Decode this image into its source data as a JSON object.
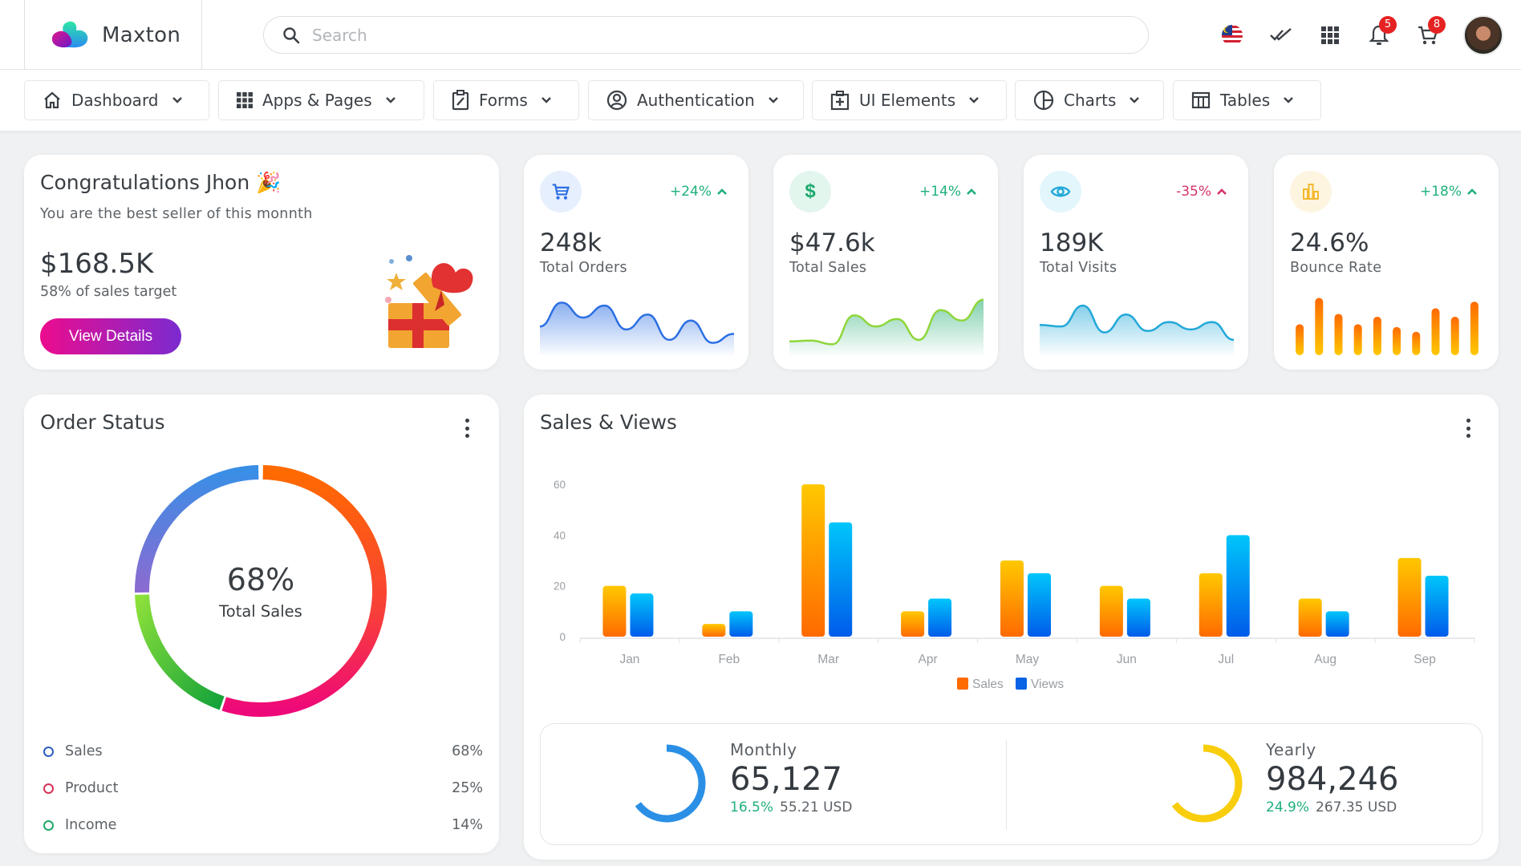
{
  "header": {
    "brand": "Maxton",
    "search_placeholder": "Search",
    "icons": [
      {
        "name": "malaysia-flag-icon"
      },
      {
        "name": "double-check-icon"
      },
      {
        "name": "apps-grid-icon"
      },
      {
        "name": "bell-icon",
        "badge": "5"
      },
      {
        "name": "cart-icon",
        "badge": "8"
      }
    ]
  },
  "nav": [
    {
      "label": "Dashboard",
      "icon": "home-icon"
    },
    {
      "label": "Apps & Pages",
      "icon": "apps-grid-icon"
    },
    {
      "label": "Forms",
      "icon": "clipboard-edit-icon"
    },
    {
      "label": "Authentication",
      "icon": "user-circle-icon"
    },
    {
      "label": "UI Elements",
      "icon": "medical-bag-icon"
    },
    {
      "label": "Charts",
      "icon": "pie-chart-icon"
    },
    {
      "label": "Tables",
      "icon": "table-icon"
    }
  ],
  "congrats": {
    "title": "Congratulations Jhon 🎉",
    "subtitle": "You are the best seller of this monnth",
    "amount": "$168.5K",
    "target": "58% of sales target",
    "button": "View Details"
  },
  "stats": [
    {
      "value": "248k",
      "label": "Total Orders",
      "change": "+24%",
      "trend": "up",
      "change_color": "#20b07a",
      "icon": "cart-icon",
      "accent": "#2c6fe3",
      "icon_bg": "#e6effd",
      "spark": {
        "type": "area",
        "values": [
          30,
          62,
          42,
          58,
          26,
          46,
          12,
          38,
          8,
          20
        ]
      }
    },
    {
      "value": "$47.6k",
      "label": "Total Sales",
      "change": "+14%",
      "trend": "up",
      "change_color": "#20b07a",
      "icon": "dollar-icon",
      "accent": "#1eaa6e",
      "icon_bg": "#e3f6ee",
      "spark": {
        "type": "area",
        "values": [
          10,
          11,
          6,
          45,
          30,
          40,
          12,
          52,
          38,
          66
        ]
      }
    },
    {
      "value": "189K",
      "label": "Total Visits",
      "change": "-35%",
      "trend": "up",
      "change_color": "#d6336c",
      "icon": "eye-icon",
      "accent": "#22a8d8",
      "icon_bg": "#e2f6fc",
      "spark": {
        "type": "area",
        "values": [
          32,
          30,
          58,
          22,
          46,
          24,
          36,
          26,
          36,
          12
        ]
      }
    },
    {
      "value": "24.6%",
      "label": "Bounce Rate",
      "change": "+18%",
      "trend": "up",
      "change_color": "#20b07a",
      "icon": "bar-chart-icon",
      "accent": "#f5b82e",
      "icon_bg": "#fdf5e0",
      "spark": {
        "type": "bar",
        "values": [
          33,
          61,
          44,
          33,
          41,
          30,
          25,
          50,
          41,
          57
        ]
      }
    }
  ],
  "order_status": {
    "title": "Order Status",
    "center_value": "68%",
    "center_label": "Total Sales",
    "legend": [
      {
        "label": "Sales",
        "value": "68%",
        "color": "#2c5fc0"
      },
      {
        "label": "Product",
        "value": "25%",
        "color": "#d63358"
      },
      {
        "label": "Income",
        "value": "14%",
        "color": "#20a86b"
      }
    ]
  },
  "sales_views": {
    "title": "Sales & Views",
    "monthly": {
      "label": "Monthly",
      "value": "65,127",
      "pct": "16.5%",
      "usd": "55.21 USD",
      "progress": 0.65,
      "color": "#2b8fe6"
    },
    "yearly": {
      "label": "Yearly",
      "value": "984,246",
      "pct": "24.9%",
      "usd": "267.35 USD",
      "progress": 0.65,
      "color": "#f8cd0b"
    }
  },
  "chart_data": [
    {
      "type": "bar",
      "title": "Sales & Views",
      "categories": [
        "Jan",
        "Feb",
        "Mar",
        "Apr",
        "May",
        "Jun",
        "Jul",
        "Aug",
        "Sep"
      ],
      "series": [
        {
          "name": "Sales",
          "values": [
            20,
            5,
            60,
            10,
            30,
            20,
            25,
            15,
            31
          ],
          "color": "#ff6a00"
        },
        {
          "name": "Views",
          "values": [
            17,
            10,
            45,
            15,
            25,
            15,
            40,
            10,
            24
          ],
          "color": "#0a62e6"
        }
      ],
      "yticks": [
        0,
        20,
        40,
        60
      ],
      "ylim": [
        0,
        60
      ],
      "xlabel": "",
      "ylabel": "",
      "grid": false,
      "legend": "bottom-center"
    },
    {
      "type": "pie",
      "title": "Order Status",
      "labels": [
        "Sales",
        "Product",
        "Income"
      ],
      "values": [
        68,
        25,
        14
      ],
      "display": "donut"
    }
  ]
}
